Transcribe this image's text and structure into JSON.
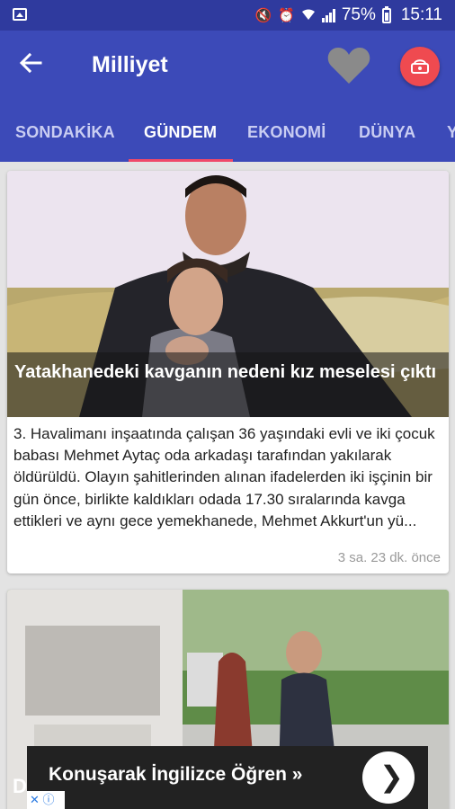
{
  "status_bar": {
    "battery": "75%",
    "time": "15:11",
    "icons": [
      "gallery-icon",
      "mute-icon",
      "alarm-icon",
      "wifi-icon",
      "signal-icon",
      "battery-charging-icon"
    ]
  },
  "app_bar": {
    "back_icon": "arrow-left-icon",
    "title": "Milliyet",
    "favorite_icon": "heart-icon",
    "share_icon": "network-icon"
  },
  "tabs": [
    {
      "label": "SONDAKİKA",
      "active": false
    },
    {
      "label": "GÜNDEM",
      "active": true
    },
    {
      "label": "EKONOMİ",
      "active": false
    },
    {
      "label": "DÜNYA",
      "active": false
    },
    {
      "label": "Y",
      "active": false
    }
  ],
  "articles": [
    {
      "headline": "Yatakhanedeki kavganın nedeni kız meselesi çıktı",
      "summary": "3. Havalimanı inşaatında çalışan 36 yaşındaki evli ve iki çocuk babası Mehmet Aytaç oda arkadaşı tarafından yakılarak öldürüldü. Olayın şahitlerinden alınan ifadelerden iki işçinin bir gün önce, birlikte kaldıkları odada 17.30 sıralarında kavga ettikleri ve aynı gece yemekhanede, Mehmet Akkurt'un yü...",
      "time": "3 sa. 23 dk. önce"
    },
    {
      "headline_visible": "D"
    }
  ],
  "ad": {
    "text": "Konuşarak İngilizce Öğren »",
    "button_icon": "chevron-right-icon",
    "adchoices": "✕ ⓘ"
  },
  "colors": {
    "status_bar": "#2f3a9e",
    "app_bar": "#3c4ab8",
    "tab_indicator": "#ef4a69",
    "fab": "#ef4a50",
    "background": "#e3e3e3"
  }
}
